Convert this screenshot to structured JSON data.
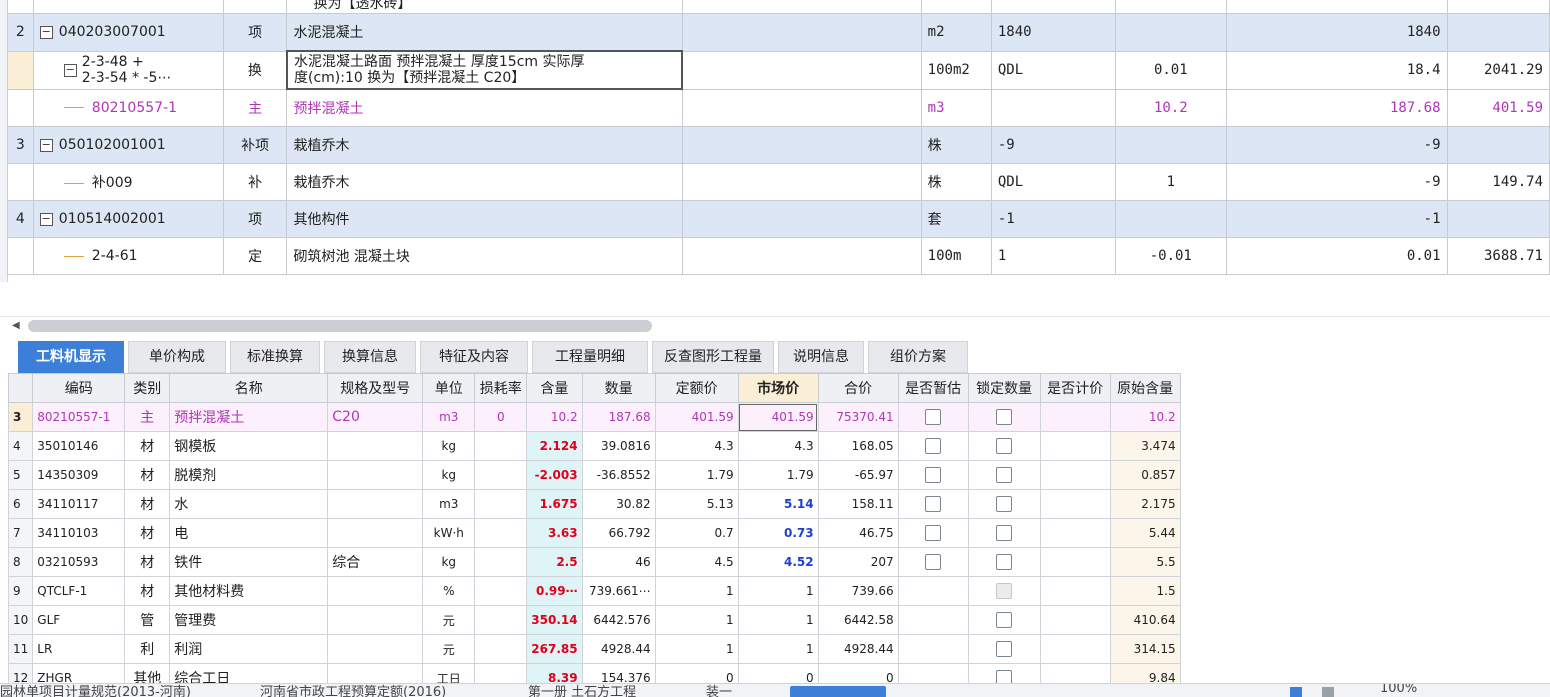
{
  "upper": {
    "top_partial_text": "换为【透水砖】",
    "rows": [
      {
        "no": "2",
        "code": "040203007001",
        "type": "项",
        "name": "水泥混凝土",
        "unit": "m2",
        "expr": "1840",
        "content": "",
        "qty": "1840",
        "price": ""
      },
      {
        "no": "",
        "code": "2-3-48 +",
        "code2": "2-3-54 * -5⋯",
        "type": "换",
        "name": "水泥混凝土路面 预拌混凝土 厚度15cm  实际厚",
        "name2": "度(cm):10  换为【预拌混凝土 C20】",
        "unit": "100m2",
        "expr": "QDL",
        "content": "0.01",
        "qty": "18.4",
        "price": "2041.29"
      },
      {
        "no": "",
        "code": "80210557-1",
        "type": "主",
        "name": "预拌混凝土",
        "unit": "m3",
        "expr": "",
        "content": "10.2",
        "qty": "187.68",
        "price": "401.59"
      },
      {
        "no": "3",
        "code": "050102001001",
        "type": "补项",
        "name": "栽植乔木",
        "unit": "株",
        "expr": "-9",
        "content": "",
        "qty": "-9",
        "price": ""
      },
      {
        "no": "",
        "code": "补009",
        "type": "补",
        "name": "栽植乔木",
        "unit": "株",
        "expr": "QDL",
        "content": "1",
        "qty": "-9",
        "price": "149.74"
      },
      {
        "no": "4",
        "code": "010514002001",
        "type": "项",
        "name": "其他构件",
        "unit": "套",
        "expr": "-1",
        "content": "",
        "qty": "-1",
        "price": ""
      },
      {
        "no": "",
        "code": "2-4-61",
        "type": "定",
        "name": "砌筑树池 混凝土块",
        "unit": "100m",
        "expr": "1",
        "content": "-0.01",
        "qty": "0.01",
        "price": "3688.71"
      }
    ]
  },
  "tabs": [
    "工料机显示",
    "单价构成",
    "标准换算",
    "换算信息",
    "特征及内容",
    "工程量明细",
    "反查图形工程量",
    "说明信息",
    "组价方案"
  ],
  "lower": {
    "headers": [
      "编码",
      "类别",
      "名称",
      "规格及型号",
      "单位",
      "损耗率",
      "含量",
      "数量",
      "定额价",
      "市场价",
      "合价",
      "是否暂估",
      "锁定数量",
      "是否计价",
      "原始含量"
    ],
    "rows": [
      {
        "no": "3",
        "code": "80210557-1",
        "cat": "主",
        "name": "预拌混凝土",
        "spec": "C20",
        "unit": "m3",
        "loss": "0",
        "content": "10.2",
        "qty": "187.68",
        "quota": "401.59",
        "market": "401.59",
        "total": "75370.41",
        "est": "box",
        "lock": "box",
        "orig": "10.2"
      },
      {
        "no": "4",
        "code": "35010146",
        "cat": "材",
        "name": "钢模板",
        "spec": "",
        "unit": "kg",
        "loss": "",
        "content": "2.124",
        "qty": "39.0816",
        "quota": "4.3",
        "market": "4.3",
        "total": "168.05",
        "est": "box",
        "lock": "box",
        "orig": "3.474"
      },
      {
        "no": "5",
        "code": "14350309",
        "cat": "材",
        "name": "脱模剂",
        "spec": "",
        "unit": "kg",
        "loss": "",
        "content": "-2.003",
        "qty": "-36.8552",
        "quota": "1.79",
        "market": "1.79",
        "total": "-65.97",
        "est": "box",
        "lock": "box",
        "orig": "0.857"
      },
      {
        "no": "6",
        "code": "34110117",
        "cat": "材",
        "name": "水",
        "spec": "",
        "unit": "m3",
        "loss": "",
        "content": "1.675",
        "qty": "30.82",
        "quota": "5.13",
        "market": "5.14",
        "total": "158.11",
        "est": "box",
        "lock": "box",
        "orig": "2.175"
      },
      {
        "no": "7",
        "code": "34110103",
        "cat": "材",
        "name": "电",
        "spec": "",
        "unit": "kW·h",
        "loss": "",
        "content": "3.63",
        "qty": "66.792",
        "quota": "0.7",
        "market": "0.73",
        "total": "46.75",
        "est": "box",
        "lock": "box",
        "orig": "5.44"
      },
      {
        "no": "8",
        "code": "03210593",
        "cat": "材",
        "name": "铁件",
        "spec": "综合",
        "unit": "kg",
        "loss": "",
        "content": "2.5",
        "qty": "46",
        "quota": "4.5",
        "market": "4.52",
        "total": "207",
        "est": "box",
        "lock": "box",
        "orig": "5.5"
      },
      {
        "no": "9",
        "code": "QTCLF-1",
        "cat": "材",
        "name": "其他材料费",
        "spec": "",
        "unit": "%",
        "loss": "",
        "content": "0.99⋯",
        "qty": "739.661⋯",
        "quota": "1",
        "market": "1",
        "total": "739.66",
        "est": "",
        "lock": "dis",
        "orig": "1.5"
      },
      {
        "no": "10",
        "code": "GLF",
        "cat": "管",
        "name": "管理费",
        "spec": "",
        "unit": "元",
        "loss": "",
        "content": "350.14",
        "qty": "6442.576",
        "quota": "1",
        "market": "1",
        "total": "6442.58",
        "est": "",
        "lock": "box",
        "orig": "410.64"
      },
      {
        "no": "11",
        "code": "LR",
        "cat": "利",
        "name": "利润",
        "spec": "",
        "unit": "元",
        "loss": "",
        "content": "267.85",
        "qty": "4928.44",
        "quota": "1",
        "market": "1",
        "total": "4928.44",
        "est": "",
        "lock": "box",
        "orig": "314.15"
      },
      {
        "no": "12",
        "code": "ZHGR",
        "cat": "其他",
        "name": "综合工日",
        "spec": "",
        "unit": "工日",
        "loss": "",
        "content": "8.39",
        "qty": "154.376",
        "quota": "0",
        "market": "0",
        "total": "0",
        "est": "",
        "lock": "box",
        "orig": "9.84"
      }
    ]
  },
  "status": {
    "seg1": "园林单项目计量规范(2013-河南)",
    "seg2": "河南省市政工程预算定额(2016)",
    "seg3": "第一册 土石方工程",
    "seg4": "装一",
    "zoom": "100%"
  },
  "colors": {
    "accent": "#3c7fd9",
    "material": "#b136b7",
    "negative": "#e0001b",
    "changed": "#1f3fd4"
  }
}
